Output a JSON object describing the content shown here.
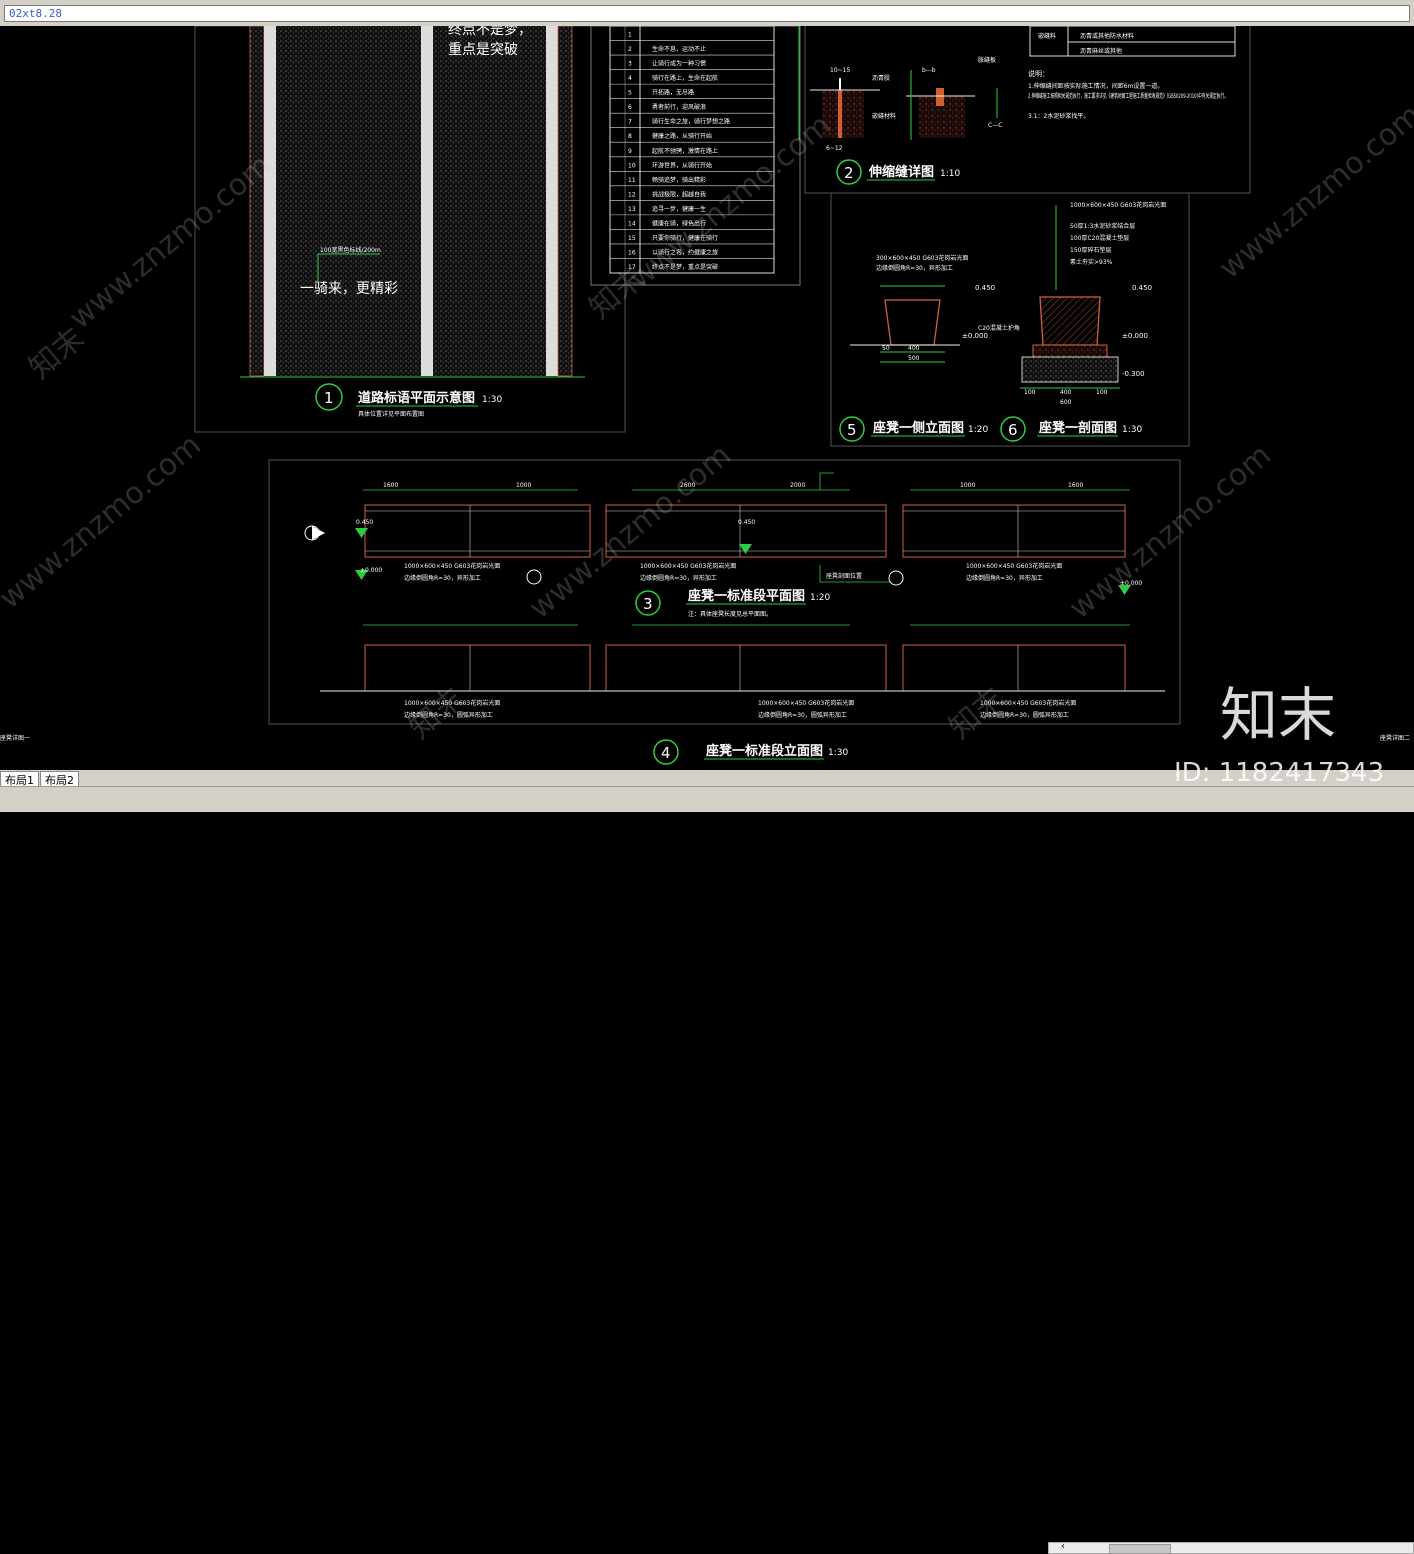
{
  "command_line": {
    "value": "02xt8.28"
  },
  "layout_tabs": [
    "布局1",
    "布局2"
  ],
  "drawing": {
    "road_slogans": [
      "终点不是梦，",
      "重点是突破",
      "一骑来，更精彩"
    ],
    "road_note": "100宽黑色标线/200m",
    "title1": {
      "num": "1",
      "text": "道路标语平面示意图",
      "scale": "1:30",
      "sub": "具体位置详见平面布置图"
    },
    "title2": {
      "num": "2",
      "text": "伸缩缝详图",
      "scale": "1:10"
    },
    "title3": {
      "num": "3",
      "text": "座凳一标准段平面图",
      "scale": "1:20",
      "sub": "注：具体座凳长度见总平面图。"
    },
    "title4": {
      "num": "4",
      "text": "座凳一标准段立面图",
      "scale": "1:30"
    },
    "title5": {
      "num": "5",
      "text": "座凳一侧立面图",
      "scale": "1:20"
    },
    "title6": {
      "num": "6",
      "text": "座凳一剖面图",
      "scale": "1:30"
    },
    "slogan_table": {
      "nums": [
        "1",
        "2",
        "3",
        "4",
        "5",
        "6",
        "7",
        "8",
        "9",
        "10",
        "11",
        "12",
        "13",
        "14",
        "15",
        "16",
        "17"
      ],
      "texts": [
        "",
        "生命不息，运动不止",
        "让骑行成为一种习惯",
        "骑行在路上，生命在起航",
        "开拓路，无尽路",
        "勇者前行，迎风破浪",
        "骑行生命之旅，骑行梦想之路",
        "健康之路，从骑行开始",
        "起航不驰骋，激情在路上",
        "环游世界，从骑行开始",
        "畅骑追梦，骑出精彩",
        "挑战极限，超越自我",
        "追寻一步，健康一生",
        "健康在骑，绿色出行",
        "只要你骑行，健康在骑行",
        "以骑行之名，约健康之旅",
        "终点不是梦，重点是突破"
      ]
    },
    "joint_labels": {
      "a": "a—a",
      "b": "b—b",
      "dim_top": "10~15",
      "material1": "沥青胶",
      "material2": "嵌缝材料",
      "material3": "胀缝板",
      "bottom": "C—C",
      "dim_side": "6~12"
    },
    "notes_title": "说明：",
    "notes": [
      "1.伸缩缝间距按实际施工情况，间距6m设置一道。",
      "2.伸缩缝施工按照相关规范执行，施工要求详见《建筑地面工程施工质量验收规范》(GB50209-2010)中有关规定执行。",
      "3.1：2水泥砂浆找平。"
    ],
    "legend_rows": [
      "填缝材料",
      "沥青或其他防水材料",
      "沥青麻丝或其他"
    ],
    "legend_head": "嵌缝料",
    "seat_layers": [
      "1000×600×450 G603花岗岩光面",
      "50厚1:3水泥砂浆结合层",
      "100厚C20混凝土垫层",
      "150厚碎石垫层",
      "素土夯实>93%"
    ],
    "seat_top_label": "300×600×450 G603花岗岩光面",
    "seat_top_sub": "边缘倒圆角R=30，异形加工",
    "c_label": "C20混凝土护角",
    "elev": {
      "a": "0.450",
      "b": "±0.000",
      "c": "-0.300"
    },
    "dims_side": [
      "50",
      "400",
      "50",
      "500"
    ],
    "dims_section": [
      "100",
      "400",
      "100",
      "600"
    ],
    "plan_dims": [
      "1600",
      "1000",
      "2600",
      "2000",
      "1000",
      "1600"
    ],
    "plan_labels": [
      "1000×600×450 G603花岗岩光面",
      "边缘倒圆角R=30，异形加工"
    ],
    "plan_marks": {
      "a": "0.450",
      "b": "±0.000"
    },
    "elev_labels": [
      "1000×600×450 G603花岗岩光面",
      "边缘倒圆角R=30，圆弧异形加工"
    ],
    "plan_section_label": "座凳剖面位置",
    "left_cut": "座凳详图一",
    "right_cut": "座凳详图二"
  },
  "watermark": {
    "brand": "知末",
    "url": "www.znzmo.com",
    "id": "ID: 1182417343"
  }
}
